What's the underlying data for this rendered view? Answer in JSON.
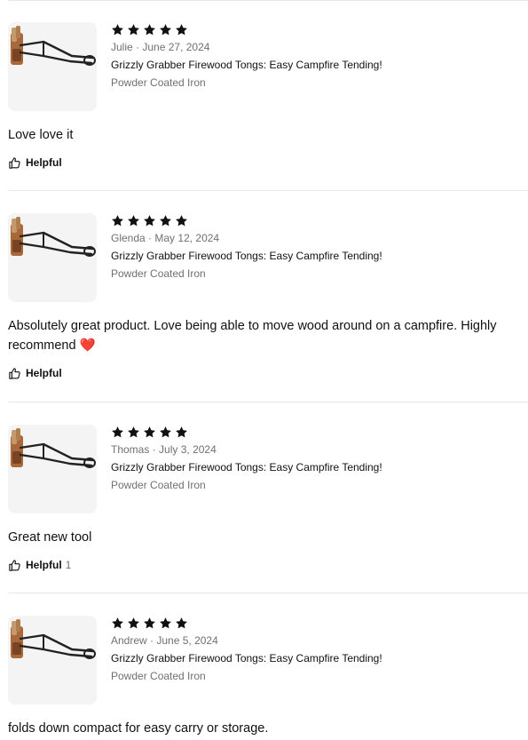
{
  "reviews": [
    {
      "rating": 5,
      "author": "Julie",
      "separator": "·",
      "date": "June 27, 2024",
      "product": "Grizzly Grabber Firewood Tongs: Easy Campfire Tending!",
      "variant": "Powder Coated Iron",
      "text": "Love love it",
      "emoji": "",
      "helpful_label": "Helpful",
      "helpful_count": ""
    },
    {
      "rating": 5,
      "author": "Glenda",
      "separator": "·",
      "date": "May 12, 2024",
      "product": "Grizzly Grabber Firewood Tongs: Easy Campfire Tending!",
      "variant": "Powder Coated Iron",
      "text": "Absolutely great product. Love being able to move wood around on a campfire. Highly recommend ",
      "emoji": "❤️",
      "helpful_label": "Helpful",
      "helpful_count": ""
    },
    {
      "rating": 5,
      "author": "Thomas",
      "separator": "·",
      "date": "July 3, 2024",
      "product": "Grizzly Grabber Firewood Tongs: Easy Campfire Tending!",
      "variant": "Powder Coated Iron",
      "text": "Great new tool",
      "emoji": "",
      "helpful_label": "Helpful",
      "helpful_count": "1"
    },
    {
      "rating": 5,
      "author": "Andrew",
      "separator": "·",
      "date": "June 5, 2024",
      "product": "Grizzly Grabber Firewood Tongs: Easy Campfire Tending!",
      "variant": "Powder Coated Iron",
      "text": "folds down compact for easy carry or storage.",
      "emoji": "",
      "helpful_label": "",
      "helpful_count": ""
    }
  ],
  "icons": {
    "star": "star-icon",
    "helpful": "thumbs-up-icon",
    "thumbnail": "product-thumbnail"
  },
  "colors": {
    "star": "#111111",
    "muted_text": "#707070",
    "divider": "#e6e6e6",
    "thumb_bg": "#f4f4f4",
    "heart": "#e0202f"
  }
}
